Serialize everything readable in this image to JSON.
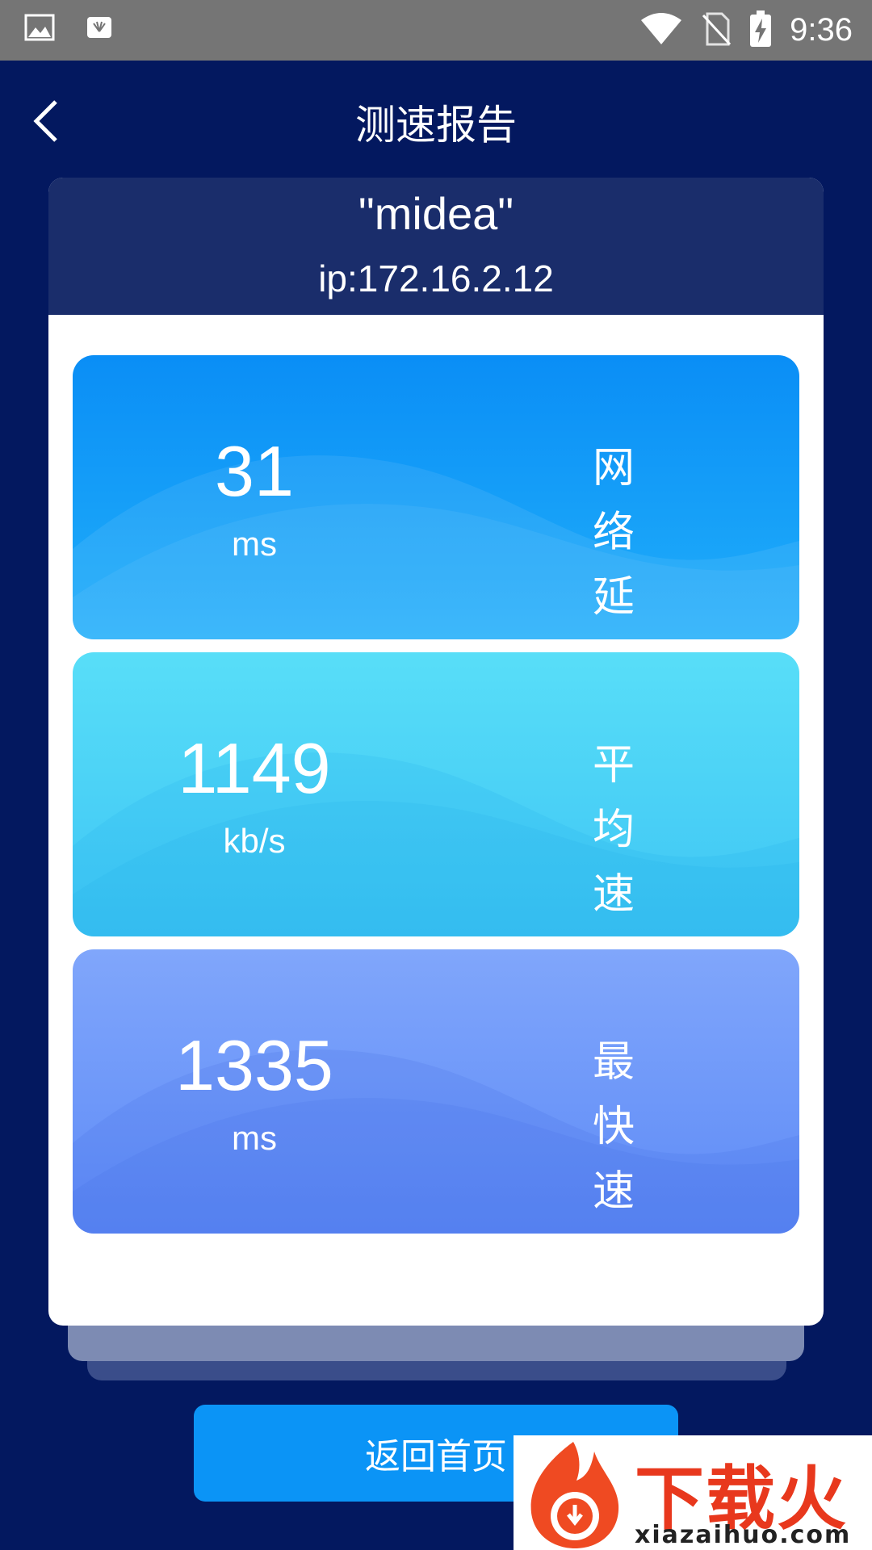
{
  "status_bar": {
    "time": "9:36",
    "icons": [
      "gallery-icon",
      "huawei-icon",
      "wifi-icon",
      "no-sim-icon",
      "battery-charging-icon"
    ]
  },
  "header": {
    "title": "测速报告",
    "back_icon": "chevron-left-icon"
  },
  "network": {
    "ssid": "\"midea\"",
    "ip": "ip:172.16.2.12"
  },
  "metrics": [
    {
      "value": "31",
      "unit": "ms",
      "label_line1": "网络",
      "label_line2": "延迟",
      "color_top": "#0a8ef6",
      "color_bottom": "#1faaf8"
    },
    {
      "value": "1149",
      "unit": "kb/s",
      "label_line1": "平均",
      "label_line2": "速度",
      "color_top": "#56dcf7",
      "color_bottom": "#3fc6f3"
    },
    {
      "value": "1335",
      "unit": "ms",
      "label_line1": "最快",
      "label_line2": "速度",
      "color_top": "#7fa5fb",
      "color_bottom": "#5f8cf7"
    }
  ],
  "footer": {
    "home_button": "返回首页"
  },
  "watermark": {
    "title": "下载火",
    "url": "xiazaihuo.com"
  }
}
